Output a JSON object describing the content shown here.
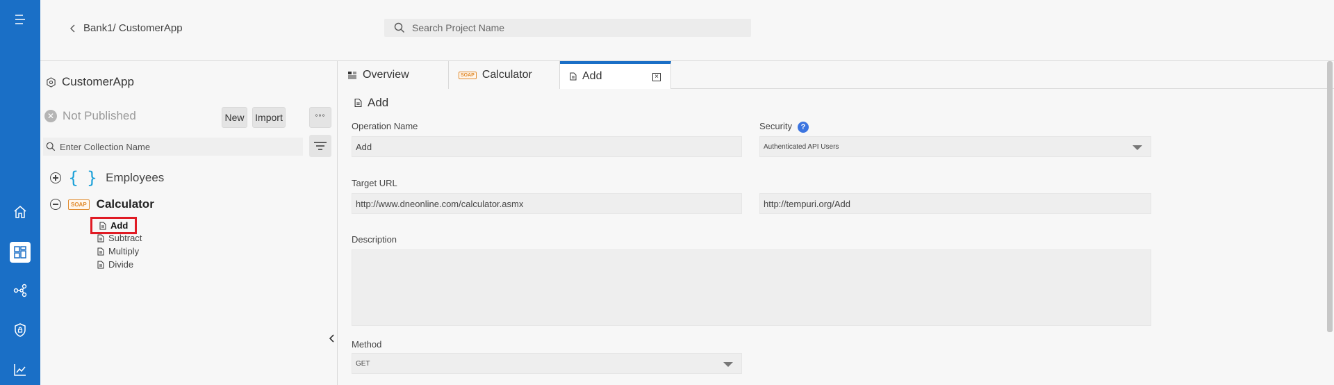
{
  "rail": {
    "items": [
      "menu",
      "home",
      "dashboard",
      "connections",
      "security",
      "analytics"
    ]
  },
  "header": {
    "breadcrumb": "Bank1/ CustomerApp",
    "search_placeholder": "Search Project Name"
  },
  "sidebar": {
    "app_name": "CustomerApp",
    "publish_status": "Not Published",
    "new_label": "New",
    "import_label": "Import",
    "more_label": "°°°",
    "collection_search_placeholder": "Enter Collection Name",
    "collections": [
      {
        "name": "Employees",
        "icon": "{ }",
        "expanded": false
      },
      {
        "name": "Calculator",
        "badge": "SOAP",
        "expanded": true,
        "operations": [
          "Add",
          "Subtract",
          "Multiply",
          "Divide"
        ]
      }
    ],
    "selected_operation": "Add"
  },
  "tabs": [
    {
      "label": "Overview",
      "icon": "overview-icon"
    },
    {
      "label": "Calculator",
      "icon": "soap-icon",
      "badge": "SOAP"
    },
    {
      "label": "Add",
      "icon": "document-icon",
      "active": true,
      "closable": true
    }
  ],
  "form": {
    "title": "Add",
    "operation_name_label": "Operation Name",
    "operation_name_value": "Add",
    "security_label": "Security",
    "security_help": "?",
    "security_value": "Authenticated API Users",
    "target_url_label": "Target URL",
    "target_url_value": "http://www.dneonline.com/calculator.asmx",
    "soap_action_value": "http://tempuri.org/Add",
    "description_label": "Description",
    "description_value": "",
    "method_label": "Method",
    "method_value": "GET"
  },
  "colors": {
    "rail": "#1a6fc6",
    "accent": "#1a6fc6",
    "selection_border": "#e01b24",
    "soap_badge": "#e08a2c",
    "braces": "#1aa0d8",
    "help": "#3b74e0"
  }
}
